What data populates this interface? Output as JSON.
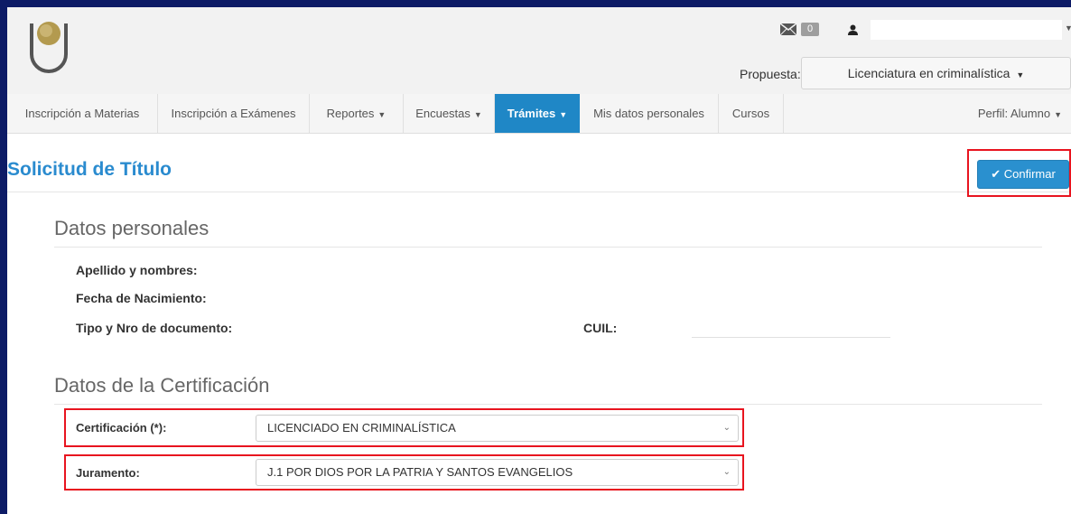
{
  "header": {
    "mail_count": "0",
    "user_name": "",
    "propuesta_label": "Propuesta:",
    "propuesta_value": "Licenciatura en criminalística"
  },
  "nav": {
    "items": [
      {
        "label": "Inscripción a Materias"
      },
      {
        "label": "Inscripción a Exámenes"
      },
      {
        "label": "Reportes"
      },
      {
        "label": "Encuestas"
      },
      {
        "label": "Trámites"
      },
      {
        "label": "Mis datos personales"
      },
      {
        "label": "Cursos"
      }
    ],
    "active": "Trámites",
    "profile": "Perfil: Alumno"
  },
  "page": {
    "title": "Solicitud de Título",
    "confirm_label": "Confirmar"
  },
  "personal": {
    "section_title": "Datos personales",
    "name_label": "Apellido y nombres:",
    "birth_label": "Fecha de Nacimiento:",
    "doc_label": "Tipo y Nro de documento:",
    "cuil_label": "CUIL:"
  },
  "certification": {
    "section_title": "Datos de la Certificación",
    "cert_label": "Certificación (*):",
    "cert_value": "LICENCIADO EN CRIMINALÍSTICA",
    "oath_label": "Juramento:",
    "oath_value": "J.1 POR DIOS POR LA PATRIA Y SANTOS EVANGELIOS"
  },
  "colors": {
    "accent": "#2a8bcf",
    "nav_active": "#1f87c6",
    "highlight": "#e8141f",
    "frame": "#0d1b66"
  },
  "icons": [
    "logo-icon",
    "mail-icon",
    "user-icon",
    "caret-down-icon",
    "check-icon",
    "chevron-down-icon"
  ]
}
